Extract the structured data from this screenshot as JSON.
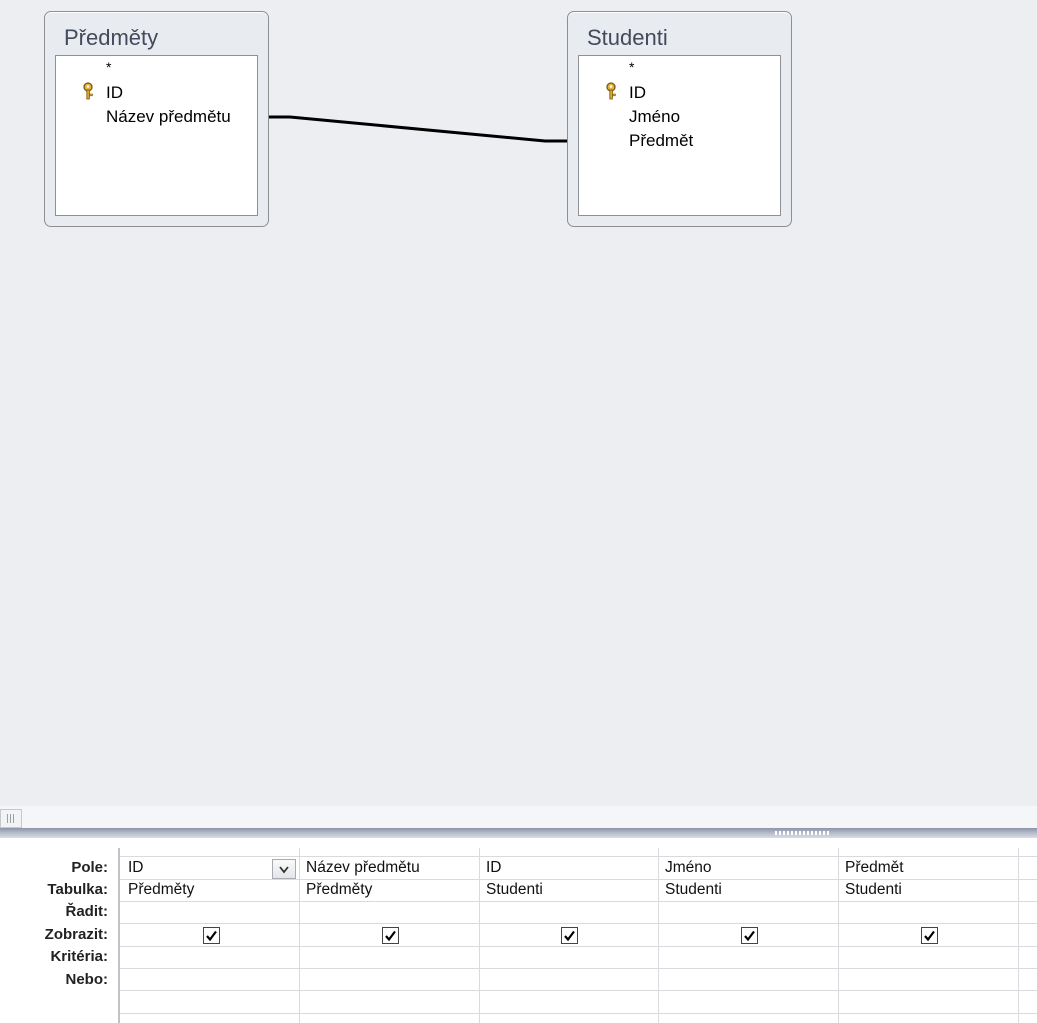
{
  "tables": [
    {
      "title": "Předměty",
      "fields": [
        "*",
        "ID",
        "Název předmětu"
      ],
      "key_field": "ID"
    },
    {
      "title": "Studenti",
      "fields": [
        "*",
        "ID",
        "Jméno",
        "Předmět"
      ],
      "key_field": "ID"
    }
  ],
  "relationship": {
    "from": "Předměty.Název předmětu",
    "to": "Studenti.Předmět"
  },
  "grid": {
    "row_labels": [
      "Pole:",
      "Tabulka:",
      "Řadit:",
      "Zobrazit:",
      "Kritéria:",
      "Nebo:"
    ],
    "columns": [
      {
        "field": "ID",
        "table": "Předměty",
        "sort": "",
        "show": true
      },
      {
        "field": "Název předmětu",
        "table": "Předměty",
        "sort": "",
        "show": true
      },
      {
        "field": "ID",
        "table": "Studenti",
        "sort": "",
        "show": true
      },
      {
        "field": "Jméno",
        "table": "Studenti",
        "sort": "",
        "show": true
      },
      {
        "field": "Předmět",
        "table": "Studenti",
        "sort": "",
        "show": true
      }
    ]
  },
  "icons": {
    "key": "key-icon",
    "dropdown": "chevron-down-icon",
    "check": "checkmark-icon"
  }
}
